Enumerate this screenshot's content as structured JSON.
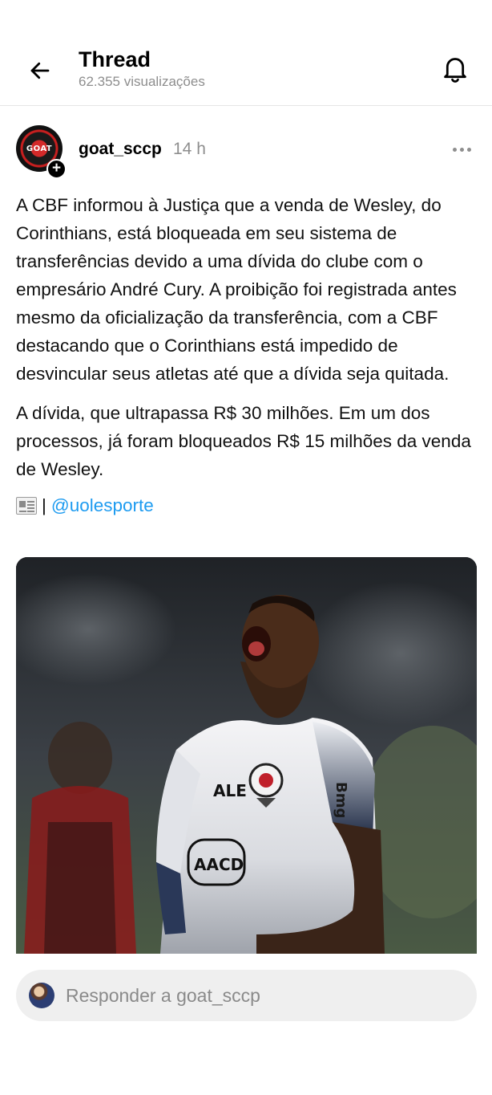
{
  "header": {
    "title": "Thread",
    "views": "62.355 visualizações"
  },
  "post": {
    "username": "goat_sccp",
    "time": "14 h",
    "avatar_text": "GOAT",
    "paragraphs": [
      "A CBF informou à Justiça que a venda de Wesley, do Corinthians, está bloqueada em seu sistema de transferências devido a uma dívida do clube com o empresário André Cury. A proibição foi registrada antes mesmo da oficialização da transferência, com a CBF destacando que o Corinthians está impedido de desvincular seus atletas até que a dívida seja quitada.",
      "A dívida, que ultrapassa R$ 30 milhões. Em um dos processos, já foram bloqueados R$ 15 milhões da venda de Wesley."
    ],
    "credit_separator": "|",
    "credit_mention": "@uolesporte",
    "image": {
      "sponsor_1": "ALE",
      "sponsor_2": "AACD",
      "sleeve_text": "Bmg",
      "icon": "football-player-photo"
    }
  },
  "reply": {
    "placeholder": "Responder a goat_sccp"
  },
  "icons": {
    "back": "arrow-left-icon",
    "bell": "bell-icon",
    "more": "more-horizontal-icon",
    "follow": "plus-icon",
    "news": "newspaper-icon"
  },
  "colors": {
    "mention": "#1d9bf0",
    "secondary_text": "#8e8e8e",
    "reply_bg": "#efefef"
  }
}
